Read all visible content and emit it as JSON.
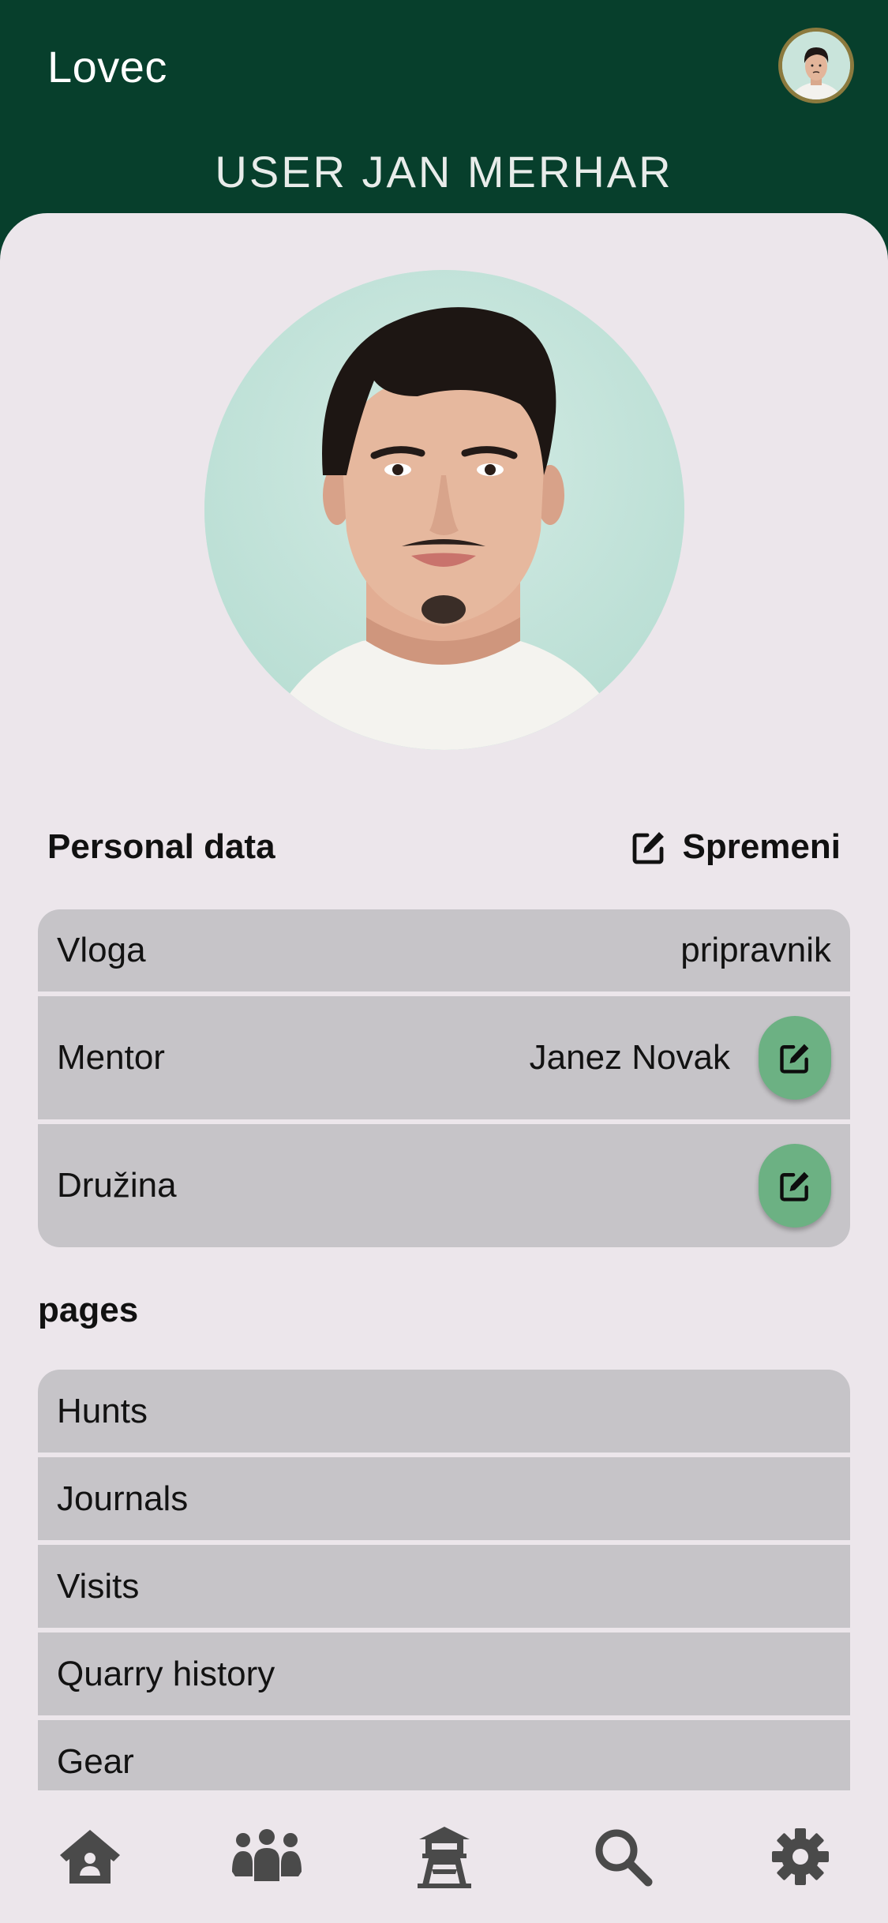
{
  "app_title": "Lovec",
  "page_title": "USER JAN MERHAR",
  "personal": {
    "heading": "Personal data",
    "edit_label": "Spremeni",
    "rows": [
      {
        "label": "Vloga",
        "value": "pripravnik"
      },
      {
        "label": "Mentor",
        "value": "Janez Novak"
      },
      {
        "label": "Družina",
        "value": ""
      }
    ]
  },
  "pages": {
    "heading": "pages",
    "items": [
      {
        "label": "Hunts"
      },
      {
        "label": "Journals"
      },
      {
        "label": "Visits"
      },
      {
        "label": "Quarry history"
      },
      {
        "label": "Gear"
      }
    ]
  },
  "bottom_nav": [
    {
      "icon": "home-icon"
    },
    {
      "icon": "users-icon"
    },
    {
      "icon": "hunting-tower-icon"
    },
    {
      "icon": "search-icon"
    },
    {
      "icon": "gear-icon"
    }
  ],
  "colors": {
    "header_bg": "#073f2c",
    "sheet_bg": "#ece6eb",
    "row_bg": "#c6c4c8",
    "fab_green": "#6cb183",
    "icon_gray": "#4a4a4a"
  }
}
